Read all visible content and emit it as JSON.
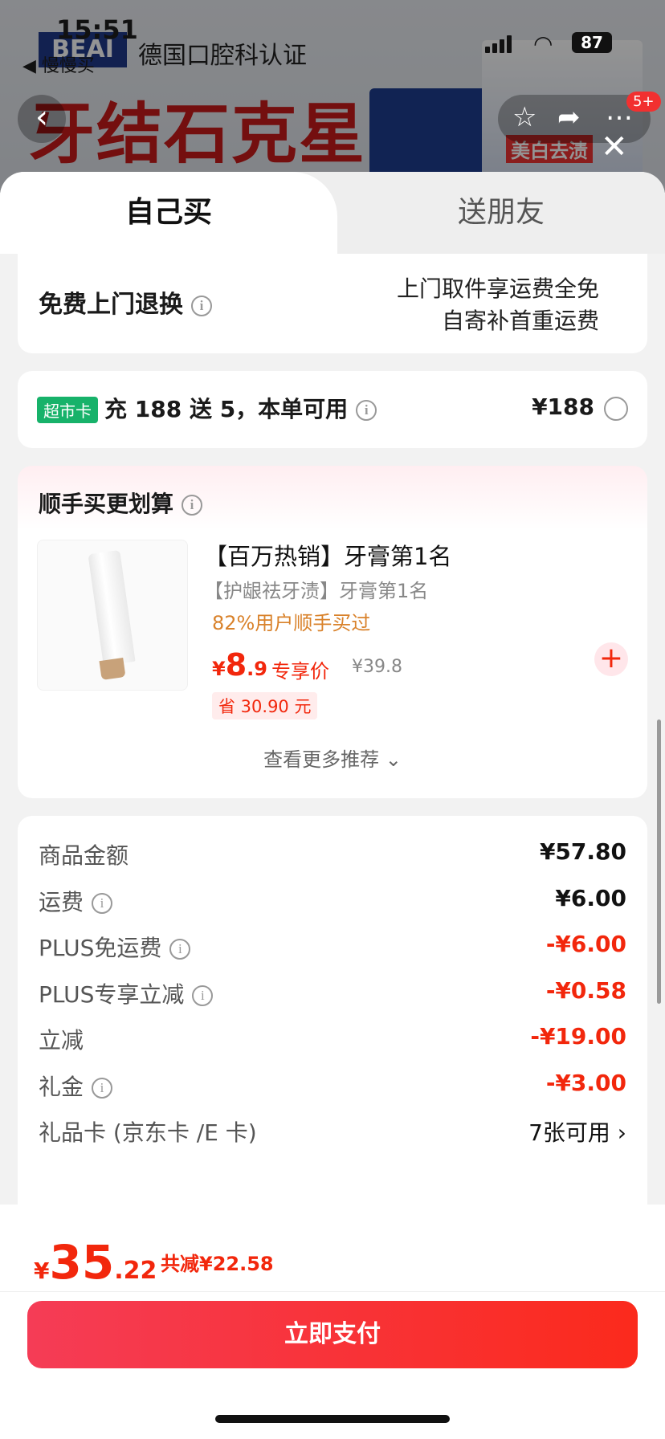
{
  "status_bar": {
    "time": "15:51",
    "back_app": "◀ 慢慢买",
    "battery": "87"
  },
  "background": {
    "brand": "BEAI",
    "certification": "德国口腔科认证",
    "headline": "牙结石克星",
    "whiten_tag": "美白去渍",
    "cart_badge": "5+"
  },
  "tabs": {
    "self": "自己买",
    "gift": "送朋友"
  },
  "return_service": {
    "title": "免费上门退换",
    "line1": "上门取件享运费全免",
    "line2": "自寄补首重运费"
  },
  "supermarket": {
    "tag": "超市卡",
    "text": "充 188 送 5，本单可用",
    "price": "¥188"
  },
  "recommend": {
    "title": "顺手买更划算",
    "product_name": "【百万热销】牙膏第1名",
    "product_sub": "【护龈祛牙渍】牙膏第1名",
    "popularity": "82%用户顺手买过",
    "price_symbol": "¥",
    "price_int": "8",
    "price_dec": ".9",
    "exclusive": "专享价",
    "original_price": "¥39.8",
    "save": "省 30.90 元",
    "more": "查看更多推荐 ⌄"
  },
  "summary": [
    {
      "label": "商品金额",
      "value": "¥57.80",
      "type": "normal",
      "info": false
    },
    {
      "label": "运费",
      "value": "¥6.00",
      "type": "normal",
      "info": true
    },
    {
      "label": "PLUS免运费",
      "value": "-¥6.00",
      "type": "neg",
      "info": true
    },
    {
      "label": "PLUS专享立减",
      "value": "-¥0.58",
      "type": "neg",
      "info": true
    },
    {
      "label": "立减",
      "value": "-¥19.00",
      "type": "neg",
      "info": false
    },
    {
      "label": "礼金",
      "value": "-¥3.00",
      "type": "neg",
      "info": true
    },
    {
      "label": "礼品卡 (京东卡 /E 卡)",
      "value": "7张可用 ›",
      "type": "gift",
      "info": false
    }
  ],
  "footer": {
    "symbol": "¥",
    "total_int": "35",
    "total_dec": ".22",
    "total_save": "共减¥22.58",
    "pay": "立即支付"
  },
  "colors": {
    "accent": "#f2270c",
    "green_tag": "#17b26a",
    "tag_bg": "#ffecec"
  }
}
